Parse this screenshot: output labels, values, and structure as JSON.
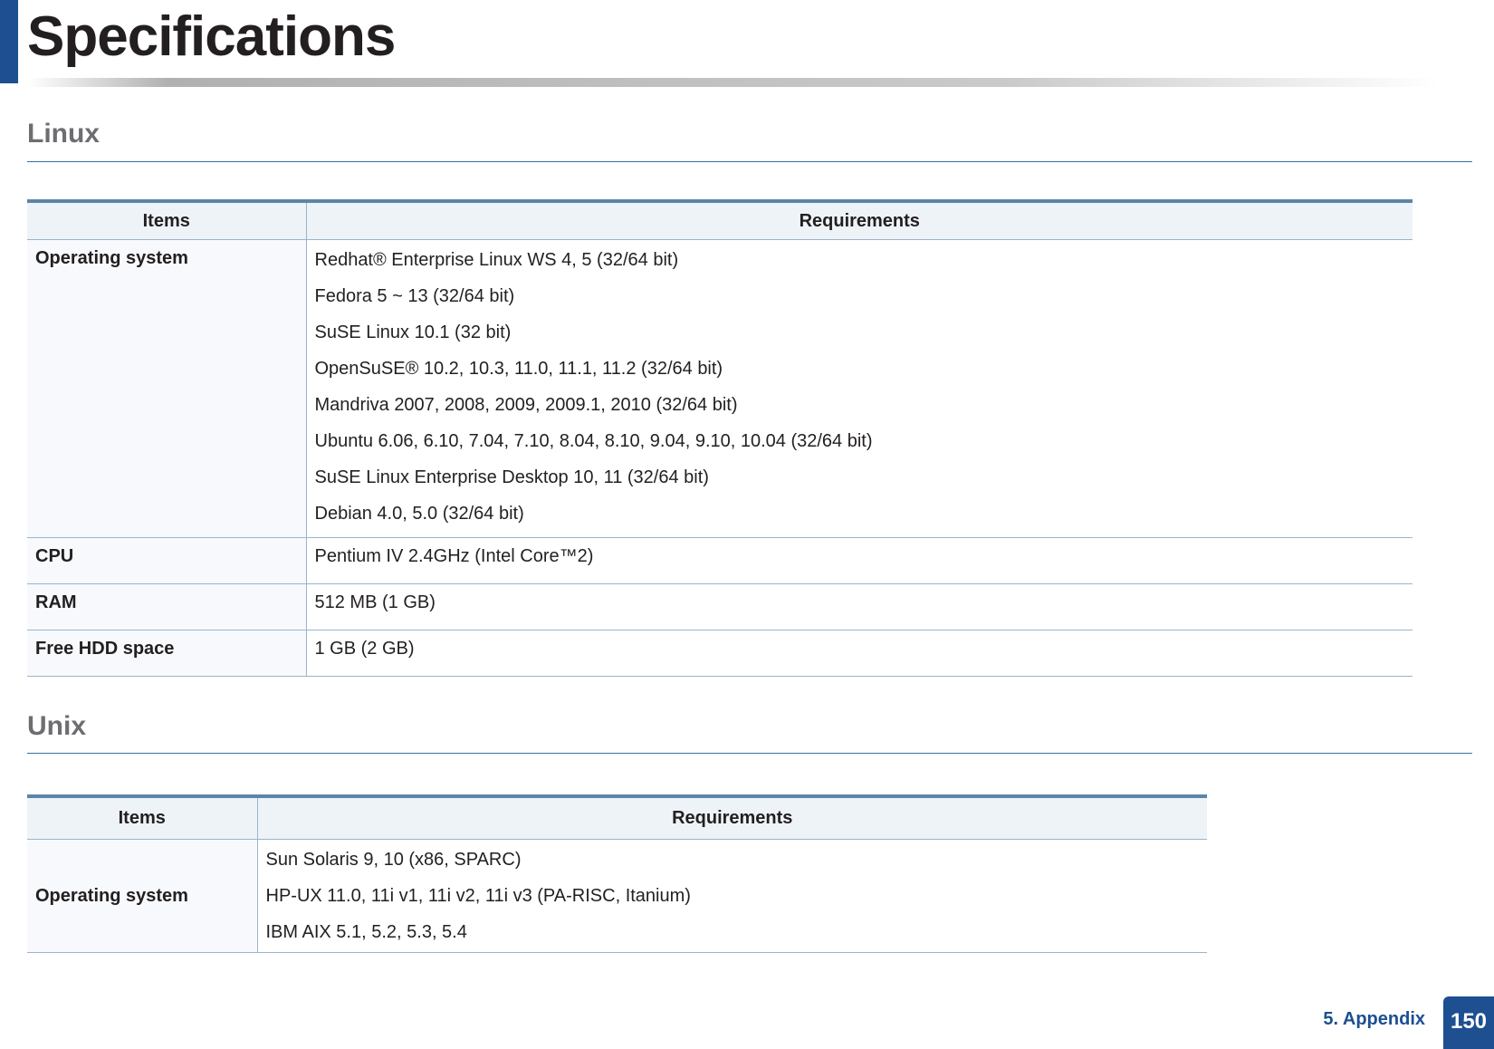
{
  "page": {
    "title": "Specifications"
  },
  "linux": {
    "heading": "Linux",
    "table": {
      "headers": [
        "Items",
        "Requirements"
      ],
      "rows": [
        {
          "item": "Operating system",
          "values": [
            "Redhat® Enterprise Linux WS 4, 5 (32/64 bit)",
            "Fedora 5 ~ 13 (32/64 bit)",
            "SuSE Linux 10.1 (32 bit)",
            "OpenSuSE® 10.2, 10.3, 11.0, 11.1, 11.2 (32/64 bit)",
            "Mandriva 2007, 2008, 2009, 2009.1, 2010 (32/64 bit)",
            "Ubuntu 6.06, 6.10, 7.04, 7.10, 8.04, 8.10, 9.04, 9.10, 10.04 (32/64 bit)",
            "SuSE Linux Enterprise Desktop 10, 11 (32/64 bit)",
            "Debian 4.0, 5.0 (32/64 bit)"
          ]
        },
        {
          "item": "CPU",
          "values": [
            "Pentium IV 2.4GHz (Intel Core™2)"
          ]
        },
        {
          "item": "RAM",
          "values": [
            "512 MB (1 GB)"
          ]
        },
        {
          "item": "Free HDD space",
          "values": [
            "1 GB (2 GB)"
          ]
        }
      ]
    }
  },
  "unix": {
    "heading": "Unix",
    "table": {
      "headers": [
        "Items",
        "Requirements"
      ],
      "rows": [
        {
          "item": "Operating system",
          "values": [
            "Sun Solaris 9, 10 (x86, SPARC)",
            "HP-UX 11.0, 11i v1, 11i v2, 11i v3 (PA-RISC, Itanium)",
            "IBM AIX 5.1, 5.2, 5.3, 5.4"
          ]
        }
      ]
    }
  },
  "footer": {
    "section": "5. Appendix",
    "page_number": "150"
  },
  "colors": {
    "accent": "#1d4f91",
    "header_bg": "#eef3f8",
    "rule": "#3a6ea5"
  }
}
